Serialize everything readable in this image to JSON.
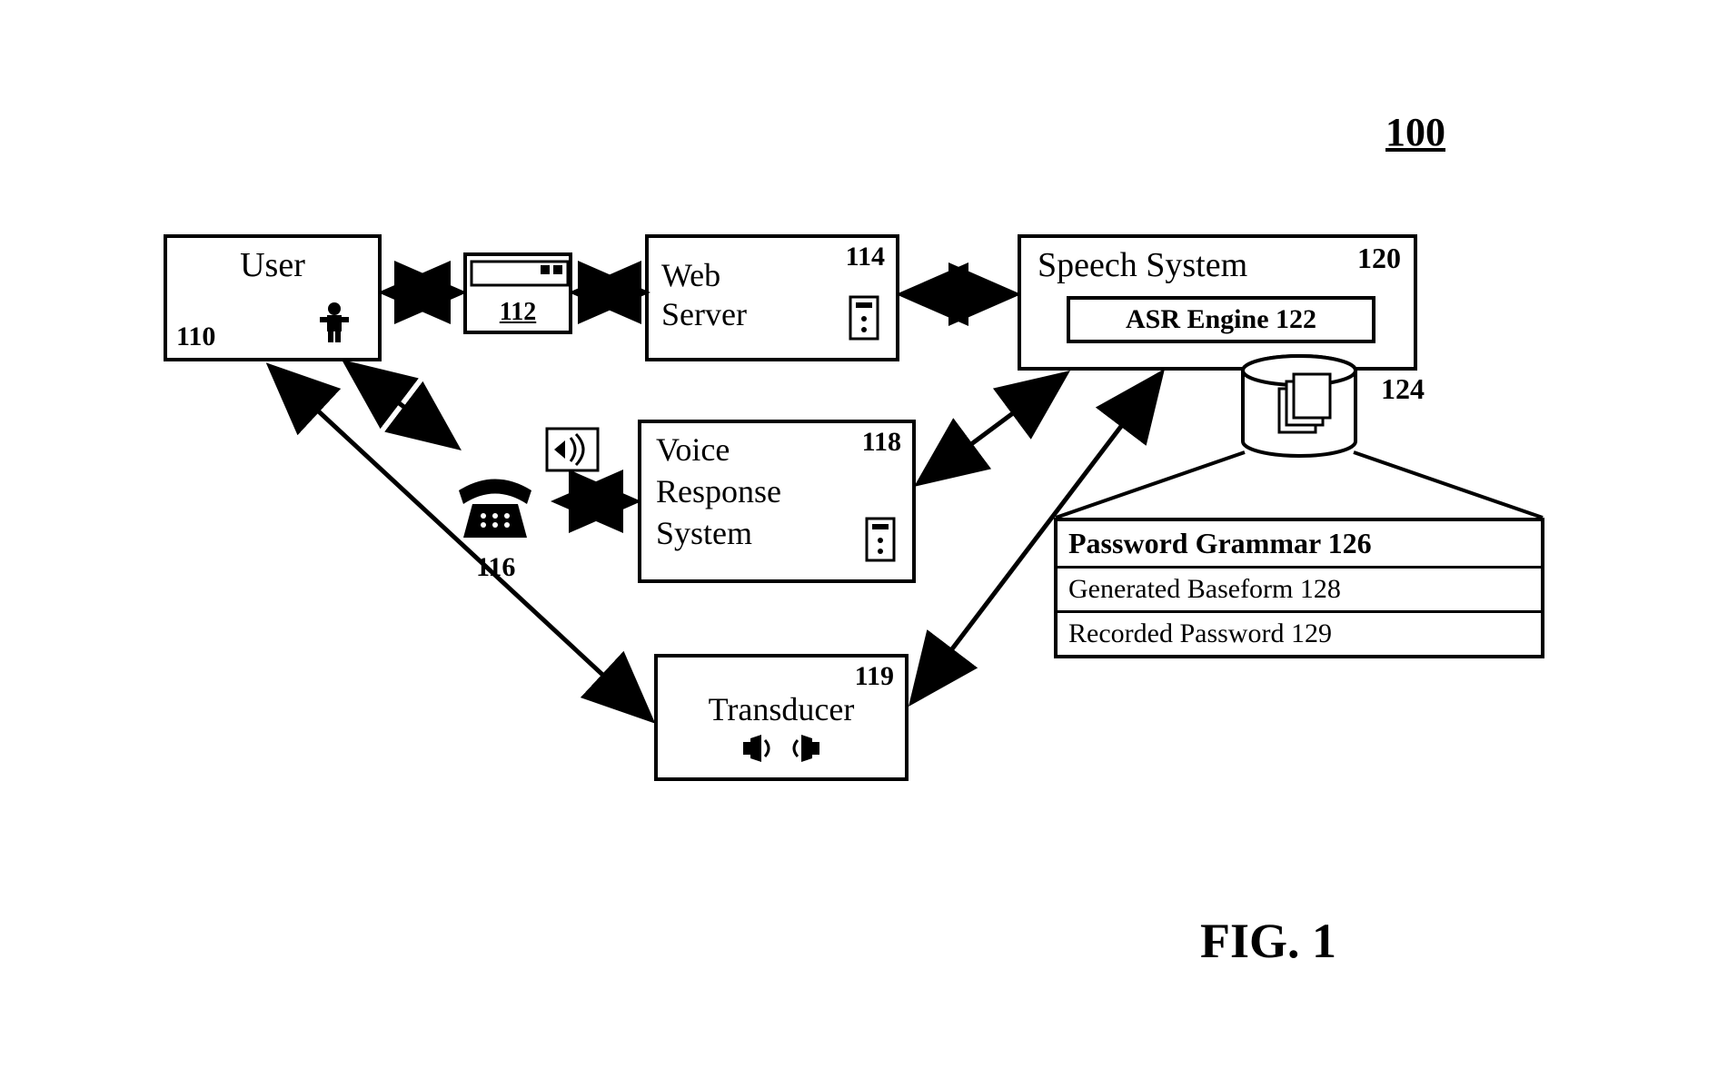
{
  "figure": {
    "id": "100",
    "caption": "FIG. 1"
  },
  "nodes": {
    "user": {
      "label": "User",
      "ref": "110",
      "icon": "person-icon"
    },
    "browser": {
      "ref": "112",
      "icon": "window-icon"
    },
    "web_server": {
      "label_line1": "Web",
      "label_line2": "Server",
      "ref": "114",
      "icon": "server-icon"
    },
    "phone": {
      "ref": "116",
      "icon": "telephone-icon",
      "icon2": "speaker-icon"
    },
    "voice_response": {
      "label_line1": "Voice",
      "label_line2": "Response",
      "label_line3": "System",
      "ref": "118",
      "icon": "server-icon"
    },
    "transducer": {
      "label": "Transducer",
      "ref": "119",
      "icon": "speakers-icon"
    },
    "speech_system": {
      "label": "Speech System",
      "ref": "120",
      "asr_label": "ASR Engine 122"
    },
    "database": {
      "ref": "124",
      "icon": "database-icon",
      "doc_icon": "documents-icon"
    },
    "password_grammar": {
      "header": "Password Grammar 126",
      "rows": [
        "Generated Baseform 128",
        "Recorded Password 129"
      ]
    }
  },
  "edges": [
    {
      "from": "user",
      "to": "browser",
      "bidirectional": true
    },
    {
      "from": "browser",
      "to": "web_server",
      "bidirectional": true
    },
    {
      "from": "web_server",
      "to": "speech_system",
      "bidirectional": true
    },
    {
      "from": "user",
      "to": "phone",
      "bidirectional": true
    },
    {
      "from": "phone",
      "to": "voice_response",
      "bidirectional": true
    },
    {
      "from": "voice_response",
      "to": "speech_system",
      "bidirectional": true
    },
    {
      "from": "user",
      "to": "transducer",
      "bidirectional": true
    },
    {
      "from": "transducer",
      "to": "speech_system",
      "bidirectional": true
    },
    {
      "from": "speech_system",
      "to": "database",
      "bidirectional": false
    },
    {
      "from": "database",
      "to": "password_grammar",
      "bidirectional": false,
      "style": "expand"
    }
  ]
}
